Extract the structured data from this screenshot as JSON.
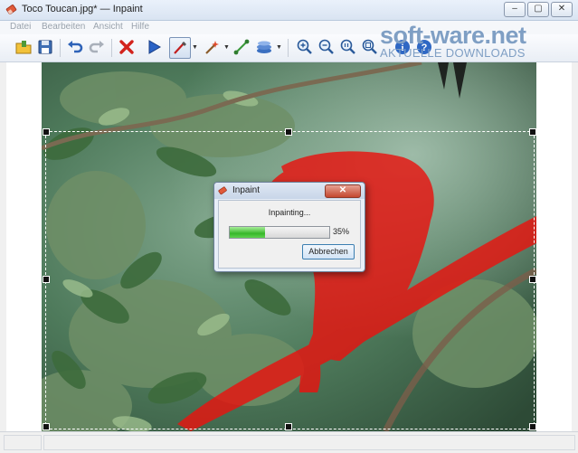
{
  "window": {
    "title": "Toco Toucan.jpg* — Inpaint",
    "controls": [
      "minimize",
      "maximize",
      "close"
    ]
  },
  "menu": {
    "items": [
      "Datei",
      "Bearbeiten",
      "Ansicht",
      "Hilfe"
    ]
  },
  "toolbar": {
    "buttons": [
      "open-icon",
      "save-icon",
      "undo-icon",
      "redo-icon",
      "delete-icon",
      "run-icon",
      "marker-tool-icon",
      "magic-wand-icon",
      "line-tool-icon",
      "layer-tool-icon",
      "zoom-in-icon",
      "zoom-out-icon",
      "zoom-actual-icon",
      "zoom-fit-icon",
      "info-icon",
      "help-icon"
    ]
  },
  "watermark": {
    "main": "soft-ware.net",
    "sub": "AKTUELLE DOWNLOADS"
  },
  "dialog": {
    "title": "Inpaint",
    "status": "Inpainting...",
    "progress": 0.35,
    "progress_label": "35%",
    "cancel_label": "Abbrechen"
  },
  "colors": {
    "mask_red": "#e8130f",
    "progress_green": "#37b72a",
    "watermark_blue": "#7f9fc4"
  }
}
